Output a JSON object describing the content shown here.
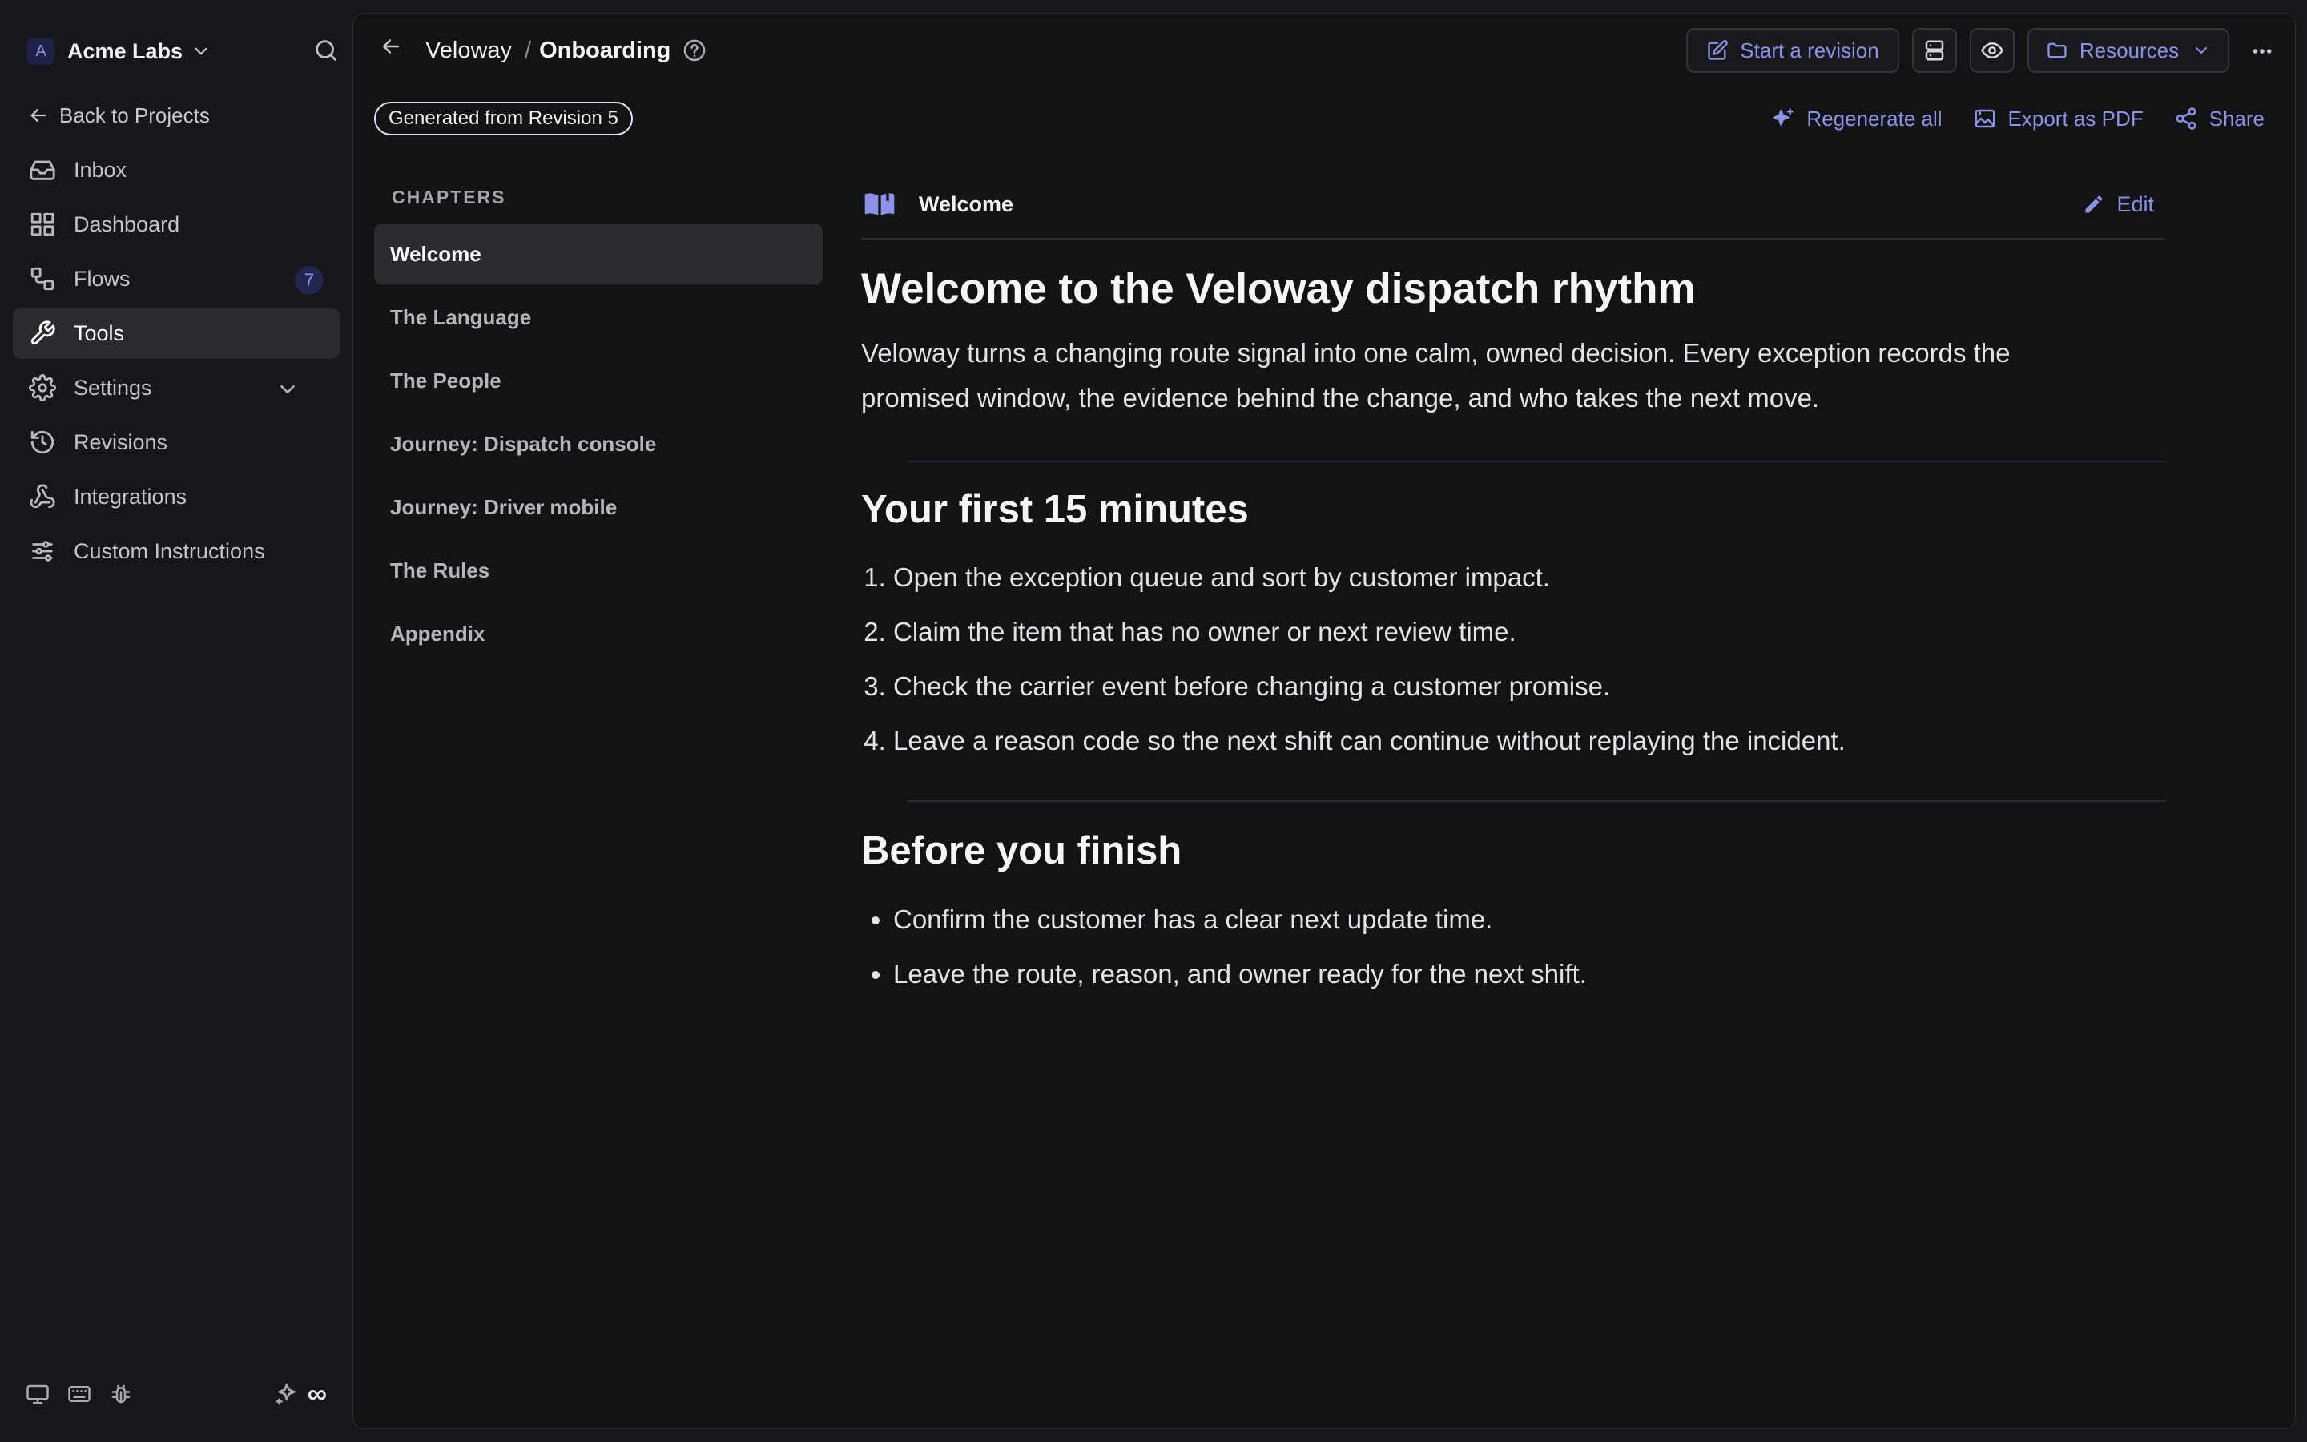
{
  "workspace": {
    "initial": "A",
    "name": "Acme Labs"
  },
  "sidebar": {
    "back_label": "Back to Projects",
    "items": [
      {
        "label": "Inbox",
        "icon": "inbox-icon"
      },
      {
        "label": "Dashboard",
        "icon": "dashboard-icon"
      },
      {
        "label": "Flows",
        "icon": "flows-icon",
        "badge": "7"
      },
      {
        "label": "Tools",
        "icon": "wrench-icon",
        "active": true
      },
      {
        "label": "Settings",
        "icon": "gear-icon",
        "expandable": true
      },
      {
        "label": "Revisions",
        "icon": "history-icon"
      },
      {
        "label": "Integrations",
        "icon": "webhook-icon"
      },
      {
        "label": "Custom Instructions",
        "icon": "sliders-icon"
      }
    ],
    "footer_symbol": "∞"
  },
  "header": {
    "project": "Veloway",
    "separator": "/",
    "page": "Onboarding",
    "buttons": {
      "start_revision": "Start a revision",
      "resources": "Resources"
    }
  },
  "toolbar": {
    "revision_pill": "Generated from Revision 5",
    "regenerate": "Regenerate all",
    "export": "Export as PDF",
    "share": "Share"
  },
  "chapters": {
    "heading": "CHAPTERS",
    "items": [
      "Welcome",
      "The Language",
      "The People",
      "Journey: Dispatch console",
      "Journey: Driver mobile",
      "The Rules",
      "Appendix"
    ],
    "active_index": 0
  },
  "document": {
    "chapter_title": "Welcome",
    "edit_label": "Edit",
    "title": "Welcome to the Veloway dispatch rhythm",
    "intro": "Veloway turns a changing route signal into one calm, owned decision. Every exception records the promised window, the evidence behind the change, and who takes the next move.",
    "section1": {
      "heading": "Your first 15 minutes",
      "steps": [
        "Open the exception queue and sort by customer impact.",
        "Claim the item that has no owner or next review time.",
        "Check the carrier event before changing a customer promise.",
        "Leave a reason code so the next shift can continue without replaying the incident."
      ]
    },
    "section2": {
      "heading": "Before you finish",
      "bullets": [
        "Confirm the customer has a clear next update time.",
        "Leave the route, reason, and owner ready for the next shift."
      ]
    }
  },
  "colors": {
    "accent": "#8d92e6",
    "background": "#121315",
    "sidebar": "#16171a"
  }
}
